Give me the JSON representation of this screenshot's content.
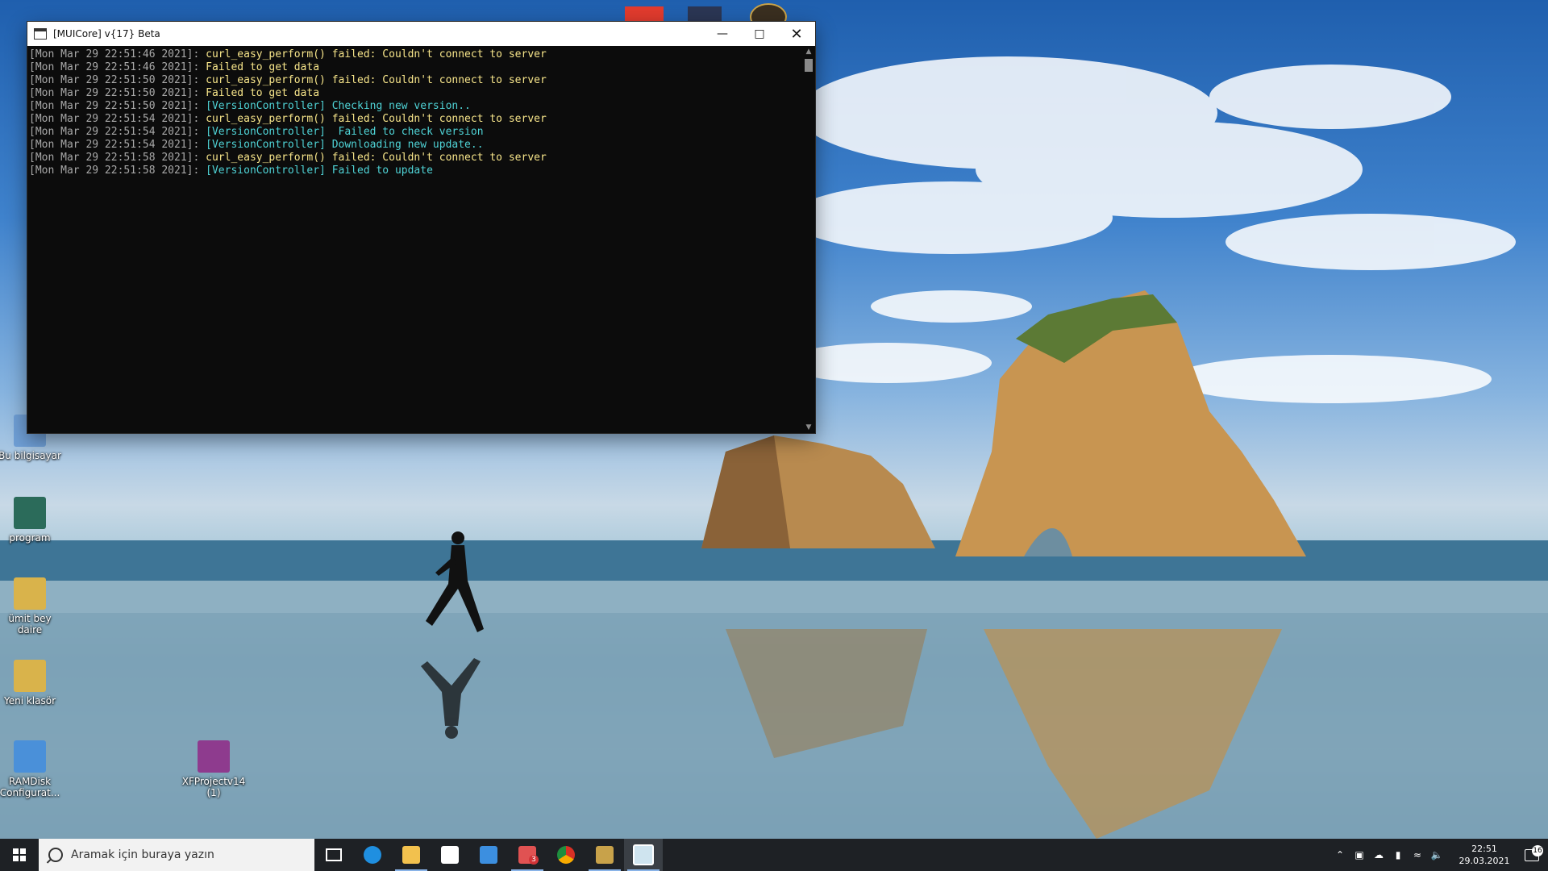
{
  "window": {
    "title": "[MUICore] v{17} Beta",
    "minimize_icon": "minimize-icon",
    "maximize_icon": "maximize-icon",
    "close_icon": "close-icon",
    "log": [
      {
        "ts": "[Mon Mar 29 22:51:46 2021]:",
        "msg": "curl_easy_perform() failed: Couldn't connect to server",
        "color": "#f7e58a"
      },
      {
        "ts": "[Mon Mar 29 22:51:46 2021]:",
        "msg": "Failed to get data",
        "color": "#f7e58a"
      },
      {
        "ts": "[Mon Mar 29 22:51:50 2021]:",
        "msg": "curl_easy_perform() failed: Couldn't connect to server",
        "color": "#f7e58a"
      },
      {
        "ts": "[Mon Mar 29 22:51:50 2021]:",
        "msg": "Failed to get data",
        "color": "#f7e58a"
      },
      {
        "ts": "[Mon Mar 29 22:51:50 2021]:",
        "msg": "[VersionController] Checking new version..",
        "color": "#4fd3d6"
      },
      {
        "ts": "[Mon Mar 29 22:51:54 2021]:",
        "msg": "curl_easy_perform() failed: Couldn't connect to server",
        "color": "#f7e58a"
      },
      {
        "ts": "[Mon Mar 29 22:51:54 2021]:",
        "msg": "[VersionController]  Failed to check version",
        "color": "#4fd3d6"
      },
      {
        "ts": "[Mon Mar 29 22:51:54 2021]:",
        "msg": "[VersionController] Downloading new update..",
        "color": "#4fd3d6"
      },
      {
        "ts": "[Mon Mar 29 22:51:58 2021]:",
        "msg": "curl_easy_perform() failed: Couldn't connect to server",
        "color": "#f7e58a"
      },
      {
        "ts": "[Mon Mar 29 22:51:58 2021]:",
        "msg": "[VersionController] Failed to update",
        "color": "#4fd3d6"
      }
    ]
  },
  "desktop": {
    "icons": [
      {
        "label": "Bu bilgisayar",
        "color": "#6f9fd6"
      },
      {
        "label": "program",
        "color": "#2b6b5a"
      },
      {
        "label": "ümit bey\ndaire",
        "color": "#d9b34b"
      },
      {
        "label": "Yeni klasör",
        "color": "#d9b34b"
      },
      {
        "label": "RAMDisk\nConfigurat...",
        "color": "#4a90d9"
      },
      {
        "label": "XFProjectv14\n(1)",
        "color": "#8e3b8e"
      }
    ]
  },
  "taskbar": {
    "search_placeholder": "Aramak için buraya yazın",
    "apps": [
      {
        "name": "task-view",
        "color": "#ffffff"
      },
      {
        "name": "edge",
        "color": "#1f8fe0"
      },
      {
        "name": "file-explorer",
        "color": "#f2c14e"
      },
      {
        "name": "store",
        "color": "#ffffff"
      },
      {
        "name": "mail",
        "color": "#3c8fe0"
      },
      {
        "name": "remote",
        "color": "#e05252"
      },
      {
        "name": "chrome",
        "color": "#e0b040"
      },
      {
        "name": "league",
        "color": "#c8a24a"
      },
      {
        "name": "console",
        "color": "#cfe4ef"
      }
    ],
    "remote_badge": "3",
    "clock_time": "22:51",
    "clock_date": "29.03.2021",
    "notification_count": "16"
  }
}
